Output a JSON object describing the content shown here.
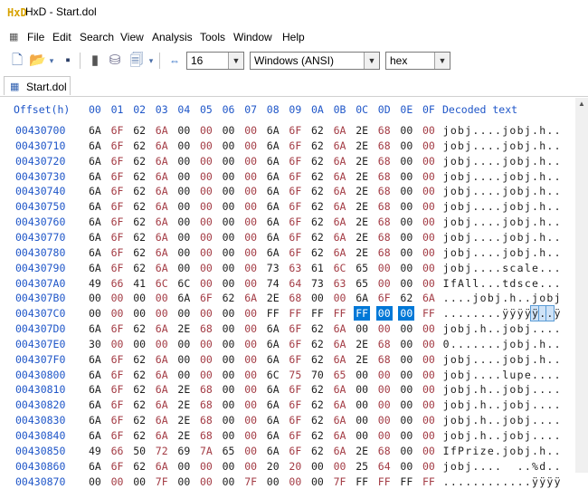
{
  "window": {
    "title": "HxD - Start.dol",
    "icon": "HxD"
  },
  "menu": [
    "File",
    "Edit",
    "Search",
    "View",
    "Analysis",
    "Tools",
    "Window",
    "Help"
  ],
  "toolbar": {
    "bytes_per_row": "16",
    "charset": "Windows (ANSI)",
    "offset_base": "hex",
    "icons": [
      "new-file-icon",
      "open-folder-icon",
      "dropdown-arrow-icon",
      "save-icon",
      "memory-icon",
      "disk-icon",
      "page-icon",
      "dropdown-arrow-icon",
      "columns-icon"
    ]
  },
  "tab": {
    "label": "Start.dol"
  },
  "editor": {
    "offset_header": "Offset(h)",
    "column_headers": [
      "00",
      "01",
      "02",
      "03",
      "04",
      "05",
      "06",
      "07",
      "08",
      "09",
      "0A",
      "0B",
      "0C",
      "0D",
      "0E",
      "0F"
    ],
    "decoded_header": "Decoded text",
    "rows": [
      {
        "offset": "00430700",
        "bytes": [
          "6A",
          "6F",
          "62",
          "6A",
          "00",
          "00",
          "00",
          "00",
          "6A",
          "6F",
          "62",
          "6A",
          "2E",
          "68",
          "00",
          "00"
        ],
        "text": "jobj....jobj.h.."
      },
      {
        "offset": "00430710",
        "bytes": [
          "6A",
          "6F",
          "62",
          "6A",
          "00",
          "00",
          "00",
          "00",
          "6A",
          "6F",
          "62",
          "6A",
          "2E",
          "68",
          "00",
          "00"
        ],
        "text": "jobj....jobj.h.."
      },
      {
        "offset": "00430720",
        "bytes": [
          "6A",
          "6F",
          "62",
          "6A",
          "00",
          "00",
          "00",
          "00",
          "6A",
          "6F",
          "62",
          "6A",
          "2E",
          "68",
          "00",
          "00"
        ],
        "text": "jobj....jobj.h.."
      },
      {
        "offset": "00430730",
        "bytes": [
          "6A",
          "6F",
          "62",
          "6A",
          "00",
          "00",
          "00",
          "00",
          "6A",
          "6F",
          "62",
          "6A",
          "2E",
          "68",
          "00",
          "00"
        ],
        "text": "jobj....jobj.h.."
      },
      {
        "offset": "00430740",
        "bytes": [
          "6A",
          "6F",
          "62",
          "6A",
          "00",
          "00",
          "00",
          "00",
          "6A",
          "6F",
          "62",
          "6A",
          "2E",
          "68",
          "00",
          "00"
        ],
        "text": "jobj....jobj.h.."
      },
      {
        "offset": "00430750",
        "bytes": [
          "6A",
          "6F",
          "62",
          "6A",
          "00",
          "00",
          "00",
          "00",
          "6A",
          "6F",
          "62",
          "6A",
          "2E",
          "68",
          "00",
          "00"
        ],
        "text": "jobj....jobj.h.."
      },
      {
        "offset": "00430760",
        "bytes": [
          "6A",
          "6F",
          "62",
          "6A",
          "00",
          "00",
          "00",
          "00",
          "6A",
          "6F",
          "62",
          "6A",
          "2E",
          "68",
          "00",
          "00"
        ],
        "text": "jobj....jobj.h.."
      },
      {
        "offset": "00430770",
        "bytes": [
          "6A",
          "6F",
          "62",
          "6A",
          "00",
          "00",
          "00",
          "00",
          "6A",
          "6F",
          "62",
          "6A",
          "2E",
          "68",
          "00",
          "00"
        ],
        "text": "jobj....jobj.h.."
      },
      {
        "offset": "00430780",
        "bytes": [
          "6A",
          "6F",
          "62",
          "6A",
          "00",
          "00",
          "00",
          "00",
          "6A",
          "6F",
          "62",
          "6A",
          "2E",
          "68",
          "00",
          "00"
        ],
        "text": "jobj....jobj.h.."
      },
      {
        "offset": "00430790",
        "bytes": [
          "6A",
          "6F",
          "62",
          "6A",
          "00",
          "00",
          "00",
          "00",
          "73",
          "63",
          "61",
          "6C",
          "65",
          "00",
          "00",
          "00"
        ],
        "text": "jobj....scale..."
      },
      {
        "offset": "004307A0",
        "bytes": [
          "49",
          "66",
          "41",
          "6C",
          "6C",
          "00",
          "00",
          "00",
          "74",
          "64",
          "73",
          "63",
          "65",
          "00",
          "00",
          "00"
        ],
        "text": "IfAll...tdsce..."
      },
      {
        "offset": "004307B0",
        "bytes": [
          "00",
          "00",
          "00",
          "00",
          "6A",
          "6F",
          "62",
          "6A",
          "2E",
          "68",
          "00",
          "00",
          "6A",
          "6F",
          "62",
          "6A"
        ],
        "text": "....jobj.h..jobj"
      },
      {
        "offset": "004307C0",
        "bytes": [
          "00",
          "00",
          "00",
          "00",
          "00",
          "00",
          "00",
          "00",
          "FF",
          "FF",
          "FF",
          "FF",
          "FF",
          "00",
          "00",
          "FF"
        ],
        "text": "........ÿÿÿÿÿ..ÿ",
        "sel_bytes": [
          12,
          13,
          14
        ],
        "sel_text": [
          12,
          13,
          14
        ]
      },
      {
        "offset": "004307D0",
        "bytes": [
          "6A",
          "6F",
          "62",
          "6A",
          "2E",
          "68",
          "00",
          "00",
          "6A",
          "6F",
          "62",
          "6A",
          "00",
          "00",
          "00",
          "00"
        ],
        "text": "jobj.h..jobj...."
      },
      {
        "offset": "004307E0",
        "bytes": [
          "30",
          "00",
          "00",
          "00",
          "00",
          "00",
          "00",
          "00",
          "6A",
          "6F",
          "62",
          "6A",
          "2E",
          "68",
          "00",
          "00"
        ],
        "text": "0.......jobj.h.."
      },
      {
        "offset": "004307F0",
        "bytes": [
          "6A",
          "6F",
          "62",
          "6A",
          "00",
          "00",
          "00",
          "00",
          "6A",
          "6F",
          "62",
          "6A",
          "2E",
          "68",
          "00",
          "00"
        ],
        "text": "jobj....jobj.h.."
      },
      {
        "offset": "00430800",
        "bytes": [
          "6A",
          "6F",
          "62",
          "6A",
          "00",
          "00",
          "00",
          "00",
          "6C",
          "75",
          "70",
          "65",
          "00",
          "00",
          "00",
          "00"
        ],
        "text": "jobj....lupe...."
      },
      {
        "offset": "00430810",
        "bytes": [
          "6A",
          "6F",
          "62",
          "6A",
          "2E",
          "68",
          "00",
          "00",
          "6A",
          "6F",
          "62",
          "6A",
          "00",
          "00",
          "00",
          "00"
        ],
        "text": "jobj.h..jobj...."
      },
      {
        "offset": "00430820",
        "bytes": [
          "6A",
          "6F",
          "62",
          "6A",
          "2E",
          "68",
          "00",
          "00",
          "6A",
          "6F",
          "62",
          "6A",
          "00",
          "00",
          "00",
          "00"
        ],
        "text": "jobj.h..jobj...."
      },
      {
        "offset": "00430830",
        "bytes": [
          "6A",
          "6F",
          "62",
          "6A",
          "2E",
          "68",
          "00",
          "00",
          "6A",
          "6F",
          "62",
          "6A",
          "00",
          "00",
          "00",
          "00"
        ],
        "text": "jobj.h..jobj...."
      },
      {
        "offset": "00430840",
        "bytes": [
          "6A",
          "6F",
          "62",
          "6A",
          "2E",
          "68",
          "00",
          "00",
          "6A",
          "6F",
          "62",
          "6A",
          "00",
          "00",
          "00",
          "00"
        ],
        "text": "jobj.h..jobj...."
      },
      {
        "offset": "00430850",
        "bytes": [
          "49",
          "66",
          "50",
          "72",
          "69",
          "7A",
          "65",
          "00",
          "6A",
          "6F",
          "62",
          "6A",
          "2E",
          "68",
          "00",
          "00"
        ],
        "text": "IfPrize.jobj.h.."
      },
      {
        "offset": "00430860",
        "bytes": [
          "6A",
          "6F",
          "62",
          "6A",
          "00",
          "00",
          "00",
          "00",
          "20",
          "20",
          "00",
          "00",
          "25",
          "64",
          "00",
          "00"
        ],
        "text": "jobj....  ..%d.."
      },
      {
        "offset": "00430870",
        "bytes": [
          "00",
          "00",
          "00",
          "7F",
          "00",
          "00",
          "00",
          "7F",
          "00",
          "00",
          "00",
          "7F",
          "FF",
          "FF",
          "FF",
          "FF"
        ],
        "text": "............ÿÿÿÿ"
      }
    ]
  }
}
